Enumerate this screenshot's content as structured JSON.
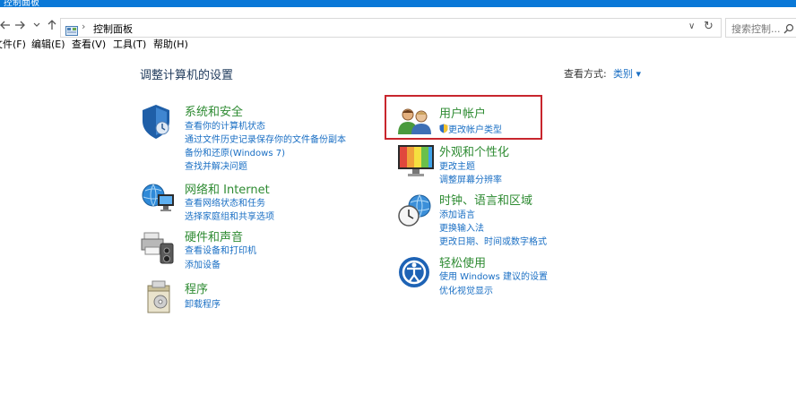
{
  "window": {
    "title": "控制面板"
  },
  "address": {
    "path": "控制面板",
    "search_placeholder": "搜索控制..."
  },
  "menu": [
    "文件(F)",
    "编辑(E)",
    "查看(V)",
    "工具(T)",
    "帮助(H)"
  ],
  "page": {
    "title": "调整计算机的设置",
    "view_by_label": "查看方式:",
    "view_by_value": "类别 ▾"
  },
  "categories_left": [
    {
      "title": "系统和安全",
      "links": [
        "查看你的计算机状态",
        "通过文件历史记录保存你的文件备份副本",
        "备份和还原(Windows 7)",
        "查找并解决问题"
      ]
    },
    {
      "title": "网络和 Internet",
      "links": [
        "查看网络状态和任务",
        "选择家庭组和共享选项"
      ]
    },
    {
      "title": "硬件和声音",
      "links": [
        "查看设备和打印机",
        "添加设备"
      ]
    },
    {
      "title": "程序",
      "links": [
        "卸载程序"
      ]
    }
  ],
  "categories_right": [
    {
      "title": "用户帐户",
      "links": [
        "更改帐户类型"
      ]
    },
    {
      "title": "外观和个性化",
      "links": [
        "更改主题",
        "调整屏幕分辨率"
      ]
    },
    {
      "title": "时钟、语言和区域",
      "links": [
        "添加语言",
        "更换输入法",
        "更改日期、时间或数字格式"
      ]
    },
    {
      "title": "轻松使用",
      "links": [
        "使用 Windows 建议的设置",
        "优化视觉显示"
      ]
    }
  ],
  "colors": {
    "titlebar": "#0a78d7",
    "category_title": "#2e8b32",
    "link": "#1a6fc4",
    "highlight": "#c8262d"
  }
}
